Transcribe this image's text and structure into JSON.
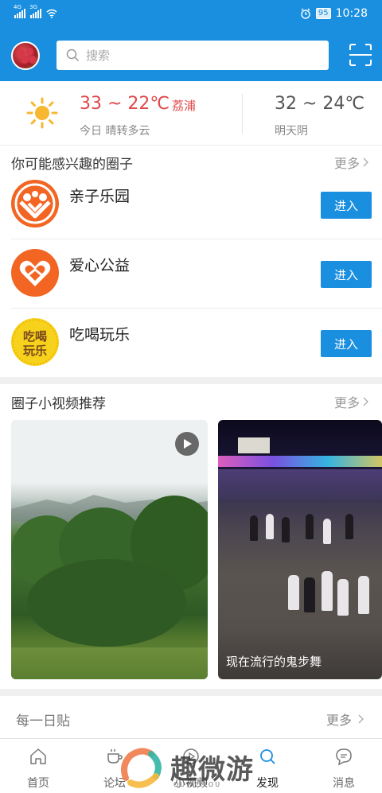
{
  "status_bar": {
    "sim1": "4G",
    "sim2": "3G",
    "battery": "95",
    "time": "10:28"
  },
  "header": {
    "search_placeholder": "搜索"
  },
  "weather": {
    "today_temp": "33 ~ 22℃",
    "city": "荔浦",
    "today_desc": "今日 晴转多云",
    "tomorrow_temp": "32 ~ 24℃",
    "tomorrow_desc": "明天阴"
  },
  "circles_section": {
    "title": "你可能感兴趣的圈子",
    "more": "更多",
    "items": [
      {
        "name": "亲子乐园",
        "button": "进入",
        "color": "#f26522"
      },
      {
        "name": "爱心公益",
        "button": "进入",
        "color": "#f26522"
      },
      {
        "name": "吃喝玩乐",
        "button": "进入",
        "color": "#f7d21c",
        "logo_text": "吃喝玩乐"
      }
    ]
  },
  "video_section": {
    "title": "圈子小视频推荐",
    "more": "更多",
    "videos": [
      {
        "caption": ""
      },
      {
        "caption": "现在流行的鬼步舞"
      }
    ]
  },
  "daily_section": {
    "title": "每一日贴",
    "more": "更多"
  },
  "tabbar": {
    "tabs": [
      {
        "label": "首页",
        "icon": "home-icon"
      },
      {
        "label": "论坛",
        "icon": "coffee-icon"
      },
      {
        "label": "小视频",
        "icon": "video-icon"
      },
      {
        "label": "发现",
        "icon": "search-icon"
      },
      {
        "label": "消息",
        "icon": "message-icon"
      }
    ]
  },
  "watermark": {
    "text": "趣微游",
    "sub": "QUWEIYOU"
  },
  "colors": {
    "primary": "#1a8fe0",
    "temp_red": "#e0484a"
  }
}
